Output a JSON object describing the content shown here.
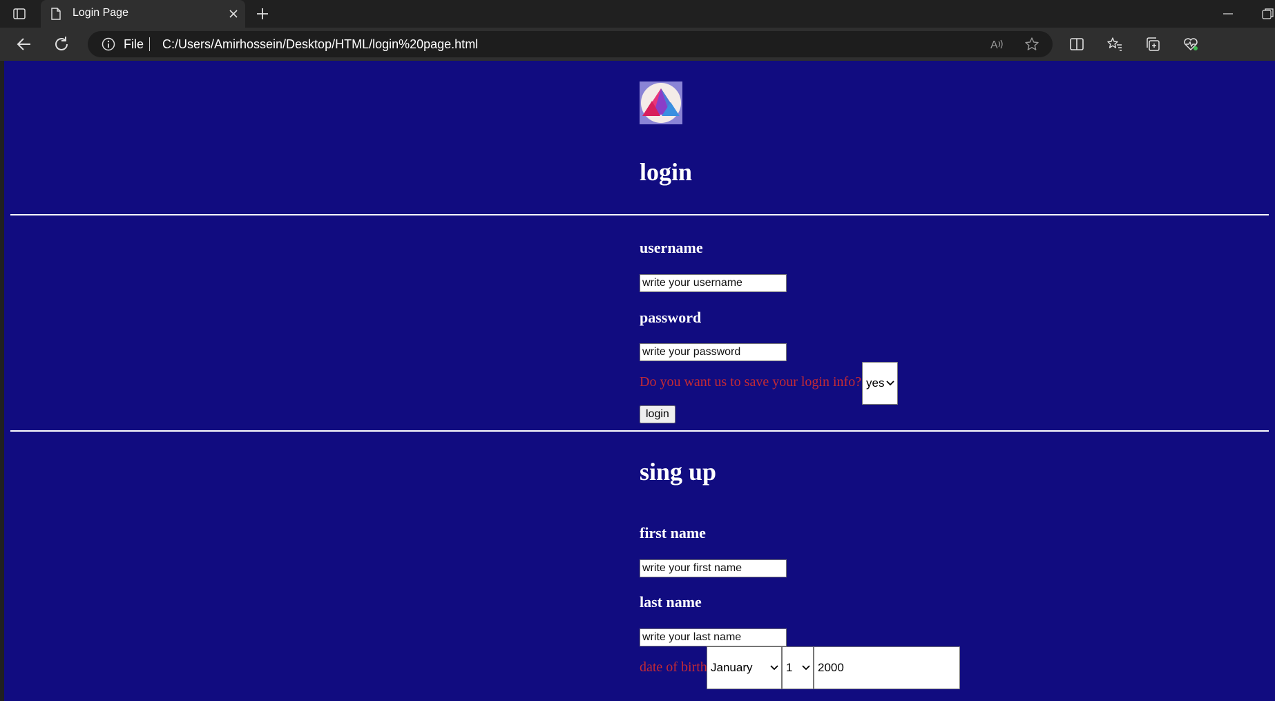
{
  "browser": {
    "tab_title": "Login Page",
    "address_scheme_label": "File",
    "url": "C:/Users/Amirhossein/Desktop/HTML/login%20page.html"
  },
  "page": {
    "background_color": "#110c80",
    "logo_icon": "mountain-logo-icon",
    "login_heading": "login",
    "username_label": "username",
    "username_placeholder": "write your username",
    "password_label": "password",
    "password_placeholder": "write your password",
    "save_question": "Do you want us to save your login info?",
    "save_option_selected": "yes",
    "login_button": "login",
    "signup_heading": "sing up",
    "first_name_label": "first name",
    "first_name_placeholder": "write your first name",
    "last_name_label": "last name",
    "last_name_placeholder": "write your last name",
    "dob_label": "date of birth",
    "dob_month": "January",
    "dob_day": "1",
    "dob_year": "2000",
    "accent_text_color": "#c42a35"
  }
}
